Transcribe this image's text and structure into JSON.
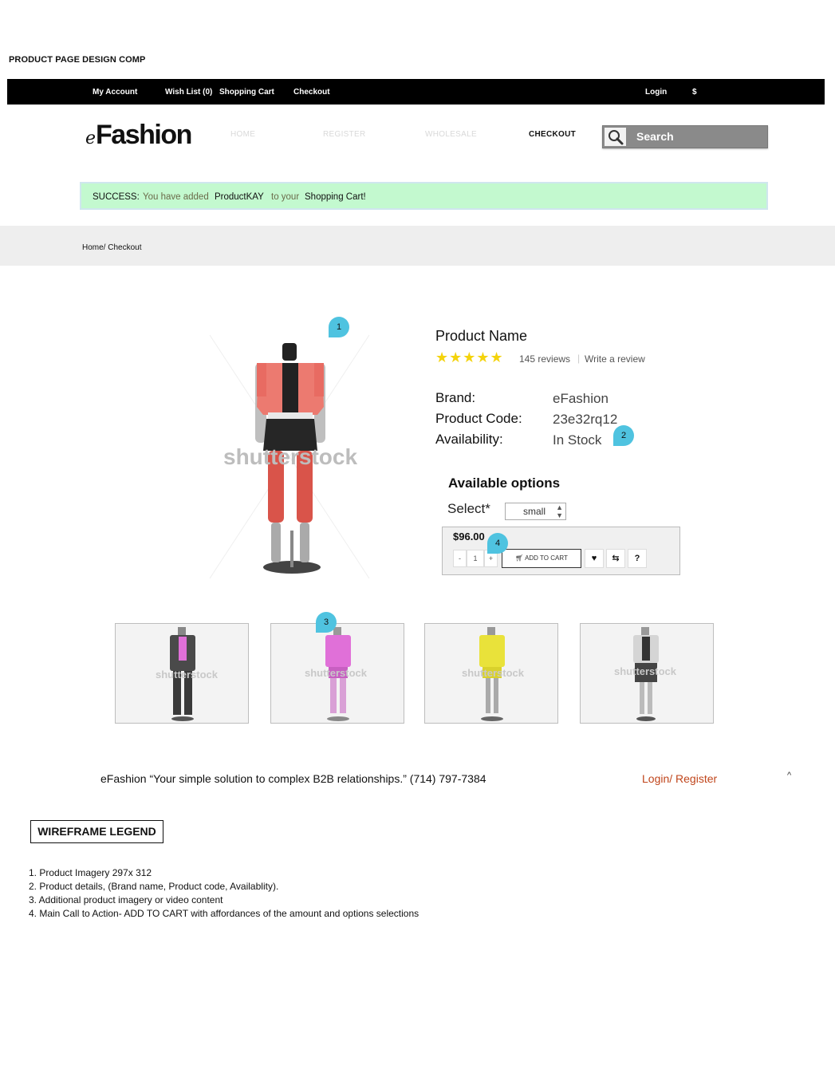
{
  "doc_title": "PRODUCT PAGE DESIGN COMP",
  "topbar": {
    "my_account": "My Account",
    "wish_list": "Wish List (0)",
    "shopping_cart": "Shopping Cart",
    "checkout": "Checkout",
    "login": "Login",
    "currency": "$"
  },
  "header": {
    "logo_prefix": "e",
    "logo_main": "Fashion",
    "nav": {
      "home": "HOME",
      "register": "REGISTER",
      "wholesale": "WHOLESALE",
      "checkout": "CHECKOUT"
    },
    "search_placeholder": "Search"
  },
  "success": {
    "label": "SUCCESS:",
    "text1": "You have added",
    "product": "ProductKAY",
    "text2": "to your",
    "cart": "Shopping Cart!"
  },
  "breadcrumb": "Home/ Checkout",
  "product_image": {
    "watermark": "shutterstock"
  },
  "pins": {
    "p1": "1",
    "p2": "2",
    "p3": "3",
    "p4": "4"
  },
  "product": {
    "name": "Product Name",
    "stars": "★★★★★",
    "rating": 5,
    "reviews": "145 reviews",
    "separator": "|",
    "write_review": "Write a review",
    "brand_label": "Brand:",
    "brand_value": "eFashion",
    "code_label": "Product Code:",
    "code_value": "23e32rq12",
    "avail_label": "Availability:",
    "avail_value": "In Stock"
  },
  "options": {
    "title": "Available options",
    "select_label": "Select*",
    "selected": "small",
    "price": "$96.00",
    "qty_minus": "-",
    "qty_value": "1",
    "qty_plus": "+",
    "add_to_cart": "ADD TO CART",
    "compare_glyph": "⇆",
    "help": "?"
  },
  "thumbnails": {
    "watermarks": [
      "shutterstock",
      "shutterstock",
      "shutterstock",
      "shutterstock"
    ],
    "colors": [
      "#3a3a3a",
      "#e070d8",
      "#e9e23a",
      "#d5d5d5"
    ]
  },
  "footer": {
    "text": "eFashion   “Your simple solution to complex B2B relationships.”  (714) 797-7384",
    "login": "Login/ Register",
    "caret": "^"
  },
  "legend": {
    "title": "WIREFRAME LEGEND",
    "items": [
      "1. Product Imagery 297x 312",
      "2. Product details, (Brand name, Product code, Availablity).",
      "3. Additional product imagery or video content",
      "4. Main Call to Action- ADD TO CART with affordances of the amount and options selections"
    ]
  }
}
